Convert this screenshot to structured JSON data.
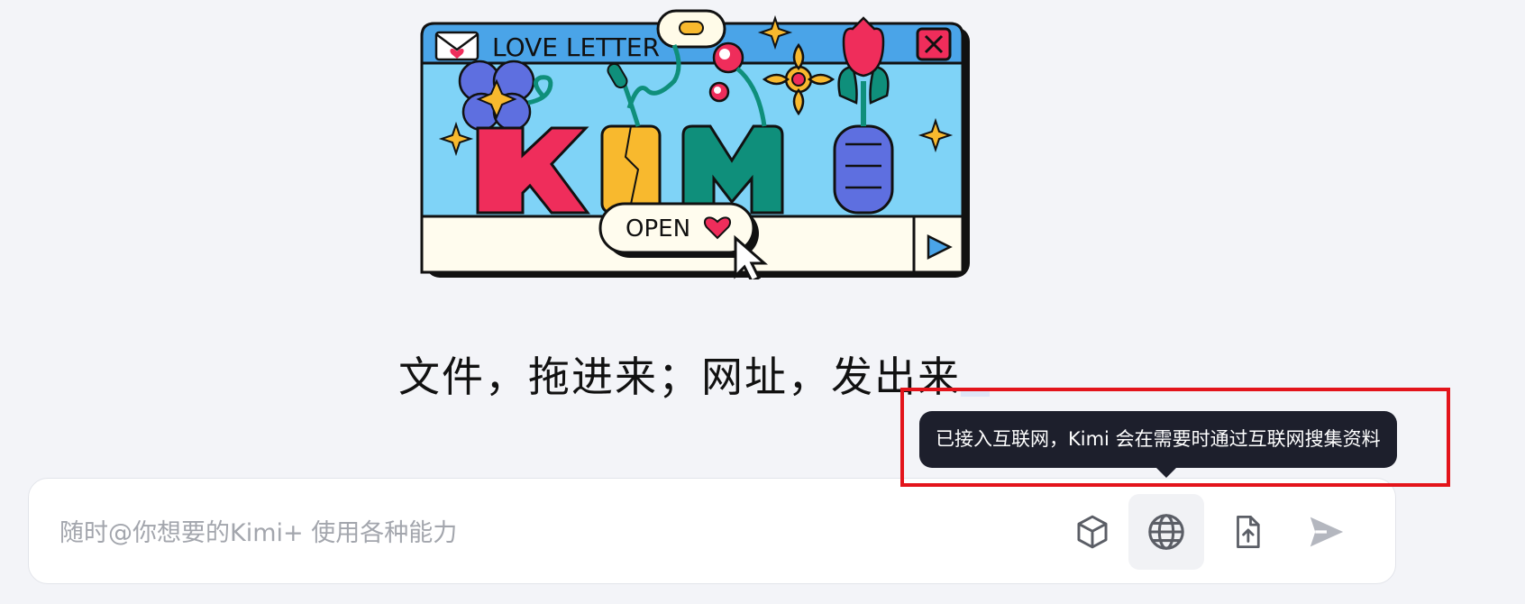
{
  "hero": {
    "window_title": "LOVE LETTER",
    "logo_text": "KIMI",
    "open_button_label": "OPEN"
  },
  "tagline": "文件，拖进来；网址，发出来",
  "tooltip": {
    "text": "已接入互联网，Kimi 会在需要时通过互联网搜集资料"
  },
  "input": {
    "placeholder": "随时@你想要的Kimi+ 使用各种能力",
    "value": ""
  },
  "toolbar": {
    "buttons": [
      {
        "name": "kimi-plus",
        "icon": "cube-icon"
      },
      {
        "name": "web-search",
        "icon": "globe-icon",
        "active": true
      },
      {
        "name": "upload-file",
        "icon": "file-upload-icon"
      },
      {
        "name": "send",
        "icon": "send-icon"
      }
    ]
  },
  "colors": {
    "background": "#f3f4f8",
    "tooltip_bg": "#1d1f2c",
    "highlight": "#e3141b",
    "icon": "#5b5e66",
    "send_icon": "#b4b7bf"
  }
}
